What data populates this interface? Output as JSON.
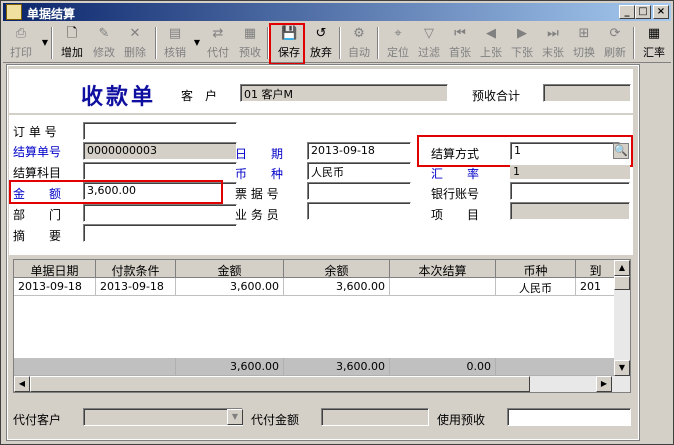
{
  "window": {
    "title": "单据结算",
    "min_label": "_",
    "max_label": "□",
    "close_label": "×"
  },
  "toolbar": {
    "print": "打印",
    "add": "增加",
    "edit": "修改",
    "delete": "删除",
    "verify": "核销",
    "agent_pay": "代付",
    "prepay": "预收",
    "save": "保存",
    "discard": "放弃",
    "auto": "自动",
    "locate": "定位",
    "filter": "过滤",
    "first": "首张",
    "prev": "上张",
    "next": "下张",
    "last": "末张",
    "switch": "切换",
    "refresh": "刷新",
    "rate": "汇率"
  },
  "header": {
    "title": "收款单",
    "customer_label": "客　户",
    "customer_value": "01  客户M",
    "prepay_total_label": "预收合计",
    "prepay_total_value": ""
  },
  "form": {
    "order_no_label": "订 单 号",
    "order_no": "",
    "settle_no_label": "结算单号",
    "settle_no": "0000000003",
    "settle_subject_label": "结算科目",
    "settle_subject": "",
    "amount_label": "金　　额",
    "amount": "3,600.00",
    "dept_label": "部　　门",
    "dept": "",
    "summary_label": "摘　　要",
    "summary": "",
    "date_label": "日　　期",
    "date": "2013-09-18",
    "currency_label": "币　　种",
    "currency": "人民币",
    "bill_no_label": "票 据 号",
    "bill_no": "",
    "salesman_label": "业 务 员",
    "salesman": "",
    "settle_method_label": "结算方式",
    "settle_method": "1",
    "rate_label": "汇　　率",
    "rate": "1",
    "bank_account_label": "银行账号",
    "bank_account": "",
    "project_label": "项　　目",
    "project": ""
  },
  "grid": {
    "columns": [
      "单据日期",
      "付款条件",
      "金额",
      "余额",
      "本次结算",
      "币种",
      "到"
    ],
    "rows": [
      {
        "date": "2013-09-18",
        "terms": "2013-09-18",
        "amount": "3,600.00",
        "balance": "3,600.00",
        "settle": "",
        "currency": "人民币",
        "due": "201"
      }
    ],
    "totals": {
      "amount": "3,600.00",
      "balance": "3,600.00",
      "settle": "0.00"
    }
  },
  "footer": {
    "agent_customer_label": "代付客户",
    "agent_customer": "",
    "agent_amount_label": "代付金额",
    "agent_amount": "",
    "use_prepay_label": "使用预收",
    "use_prepay": ""
  },
  "colors": {
    "title_blue": "#1010a0",
    "label_blue": "#0000c8",
    "highlight_red": "#e00000"
  }
}
